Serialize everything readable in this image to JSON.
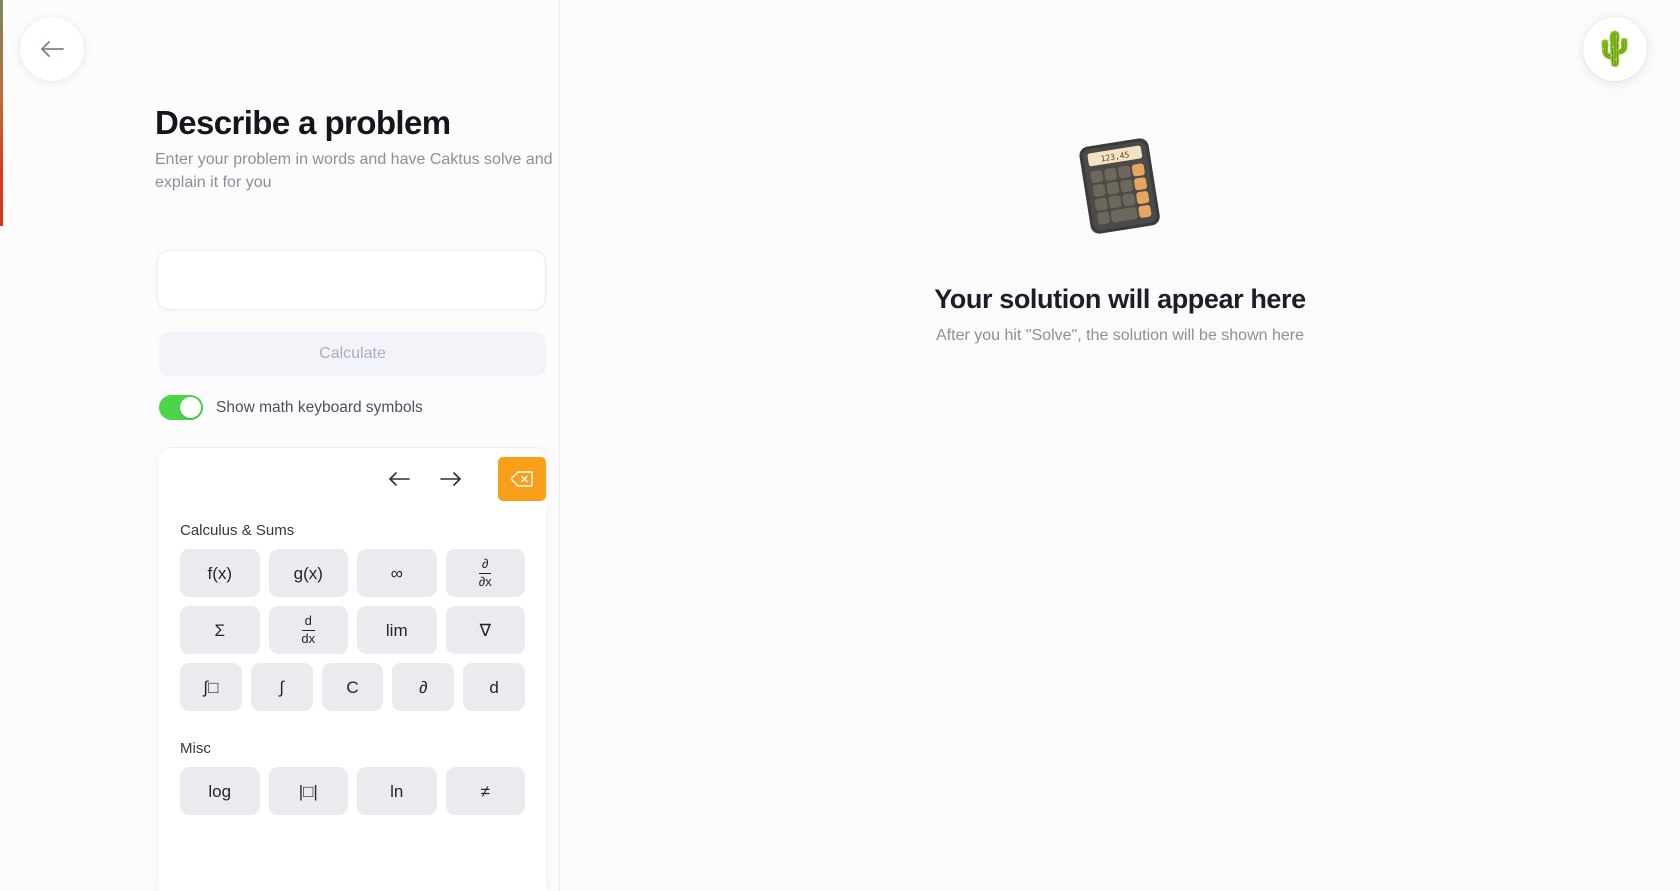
{
  "nav": {
    "back_label": "Back",
    "back_icon": "arrow-left-icon",
    "avatar_emoji": "🌵",
    "avatar_alt": "Cactus avatar"
  },
  "left": {
    "title": "Describe a problem",
    "subtitle": "Enter your problem in words and have Caktus solve and explain it for you",
    "input": {
      "value": "",
      "placeholder": ""
    },
    "calculate_label": "Calculate",
    "toggle": {
      "label": "Show math keyboard symbols",
      "on": true,
      "on_color": "#4bd54b"
    }
  },
  "keyboard": {
    "toolbar": {
      "left_arrow": "←",
      "right_arrow": "→",
      "backspace_icon": "backspace-icon",
      "backspace_color": "#f9a01b"
    },
    "sections": [
      {
        "title": "Calculus & Sums",
        "rows": [
          [
            {
              "id": "f-of-x",
              "label": "f(x)"
            },
            {
              "id": "g-of-x",
              "label": "g(x)"
            },
            {
              "id": "infinity",
              "label": "∞"
            },
            {
              "id": "partial-derivative",
              "label": "∂/∂x",
              "num": "∂",
              "den": "∂x"
            }
          ],
          [
            {
              "id": "sigma-sum",
              "label": "Σ"
            },
            {
              "id": "derivative",
              "label": "d/dx",
              "num": "d",
              "den": "dx"
            },
            {
              "id": "limit",
              "label": "lim"
            },
            {
              "id": "nabla",
              "label": "∇"
            }
          ],
          [
            {
              "id": "definite-integral",
              "label": "∫□"
            },
            {
              "id": "integral",
              "label": "∫"
            },
            {
              "id": "constant-c",
              "label": "C"
            },
            {
              "id": "partial",
              "label": "∂"
            },
            {
              "id": "differential-d",
              "label": "d"
            }
          ]
        ]
      },
      {
        "title": "Misc",
        "rows": [
          [
            {
              "id": "log",
              "label": "log"
            },
            {
              "id": "absolute-value",
              "label": "|□|"
            },
            {
              "id": "natural-log",
              "label": "ln"
            },
            {
              "id": "not-equal",
              "label": "≠"
            }
          ]
        ]
      }
    ]
  },
  "right": {
    "illustration": "calculator-emoji",
    "calculator_display": "123,45",
    "heading": "Your solution will appear here",
    "subtext": "After you hit \"Solve\", the solution will be shown here"
  }
}
